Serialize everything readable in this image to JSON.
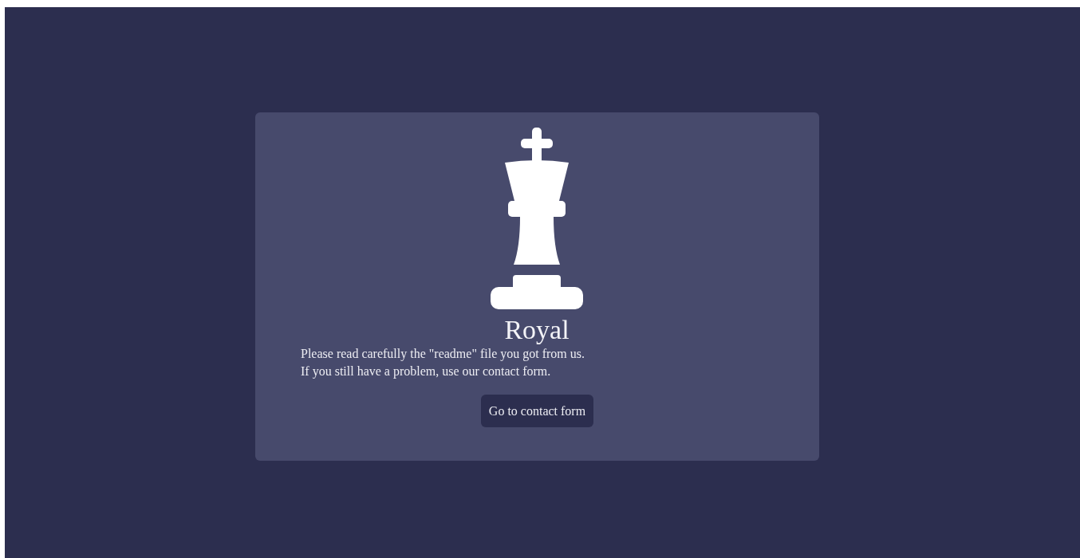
{
  "card": {
    "title": "Royal",
    "message": [
      "Please read carefully the \"readme\" file you got from us.",
      "If you still have a problem, use our contact form."
    ],
    "button": "Go to contact form"
  }
}
